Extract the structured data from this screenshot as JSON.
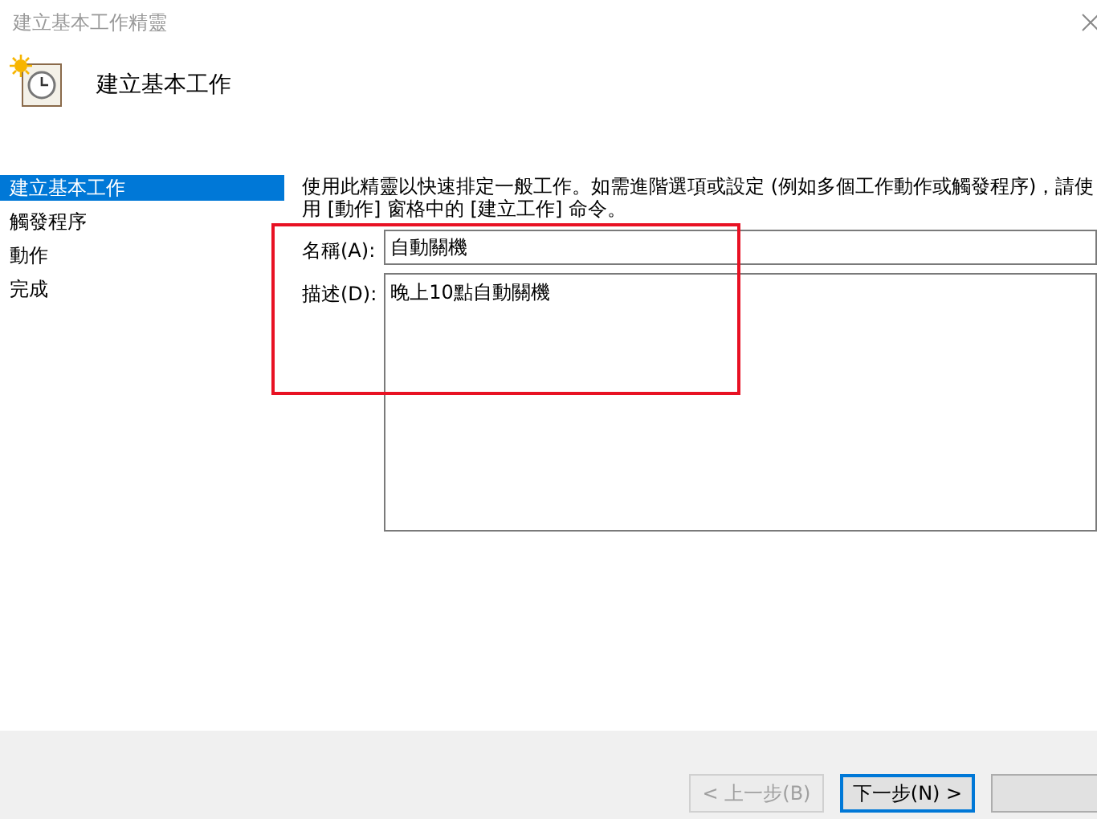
{
  "window": {
    "title": "建立基本工作精靈"
  },
  "header": {
    "title": "建立基本工作"
  },
  "sidebar": {
    "items": [
      {
        "label": "建立基本工作",
        "selected": true
      },
      {
        "label": "觸發程序",
        "selected": false
      },
      {
        "label": "動作",
        "selected": false
      },
      {
        "label": "完成",
        "selected": false
      }
    ]
  },
  "content": {
    "intro": "使用此精靈以快速排定一般工作。如需進階選項或設定 (例如多個工作動作或觸發程序)，請使用 [動作] 窗格中的 [建立工作] 命令。",
    "fields": [
      {
        "label": "名稱(A):",
        "value": "自動關機",
        "kind": "line"
      },
      {
        "label": "描述(D):",
        "value": "晚上10點自動關機",
        "kind": "area"
      }
    ]
  },
  "buttons": [
    {
      "label": "< 上一步(B)",
      "disabled": true,
      "focused": false
    },
    {
      "label": "下一步(N) >",
      "disabled": false,
      "focused": true
    },
    {
      "disabled": false,
      "focused": false
    }
  ]
}
